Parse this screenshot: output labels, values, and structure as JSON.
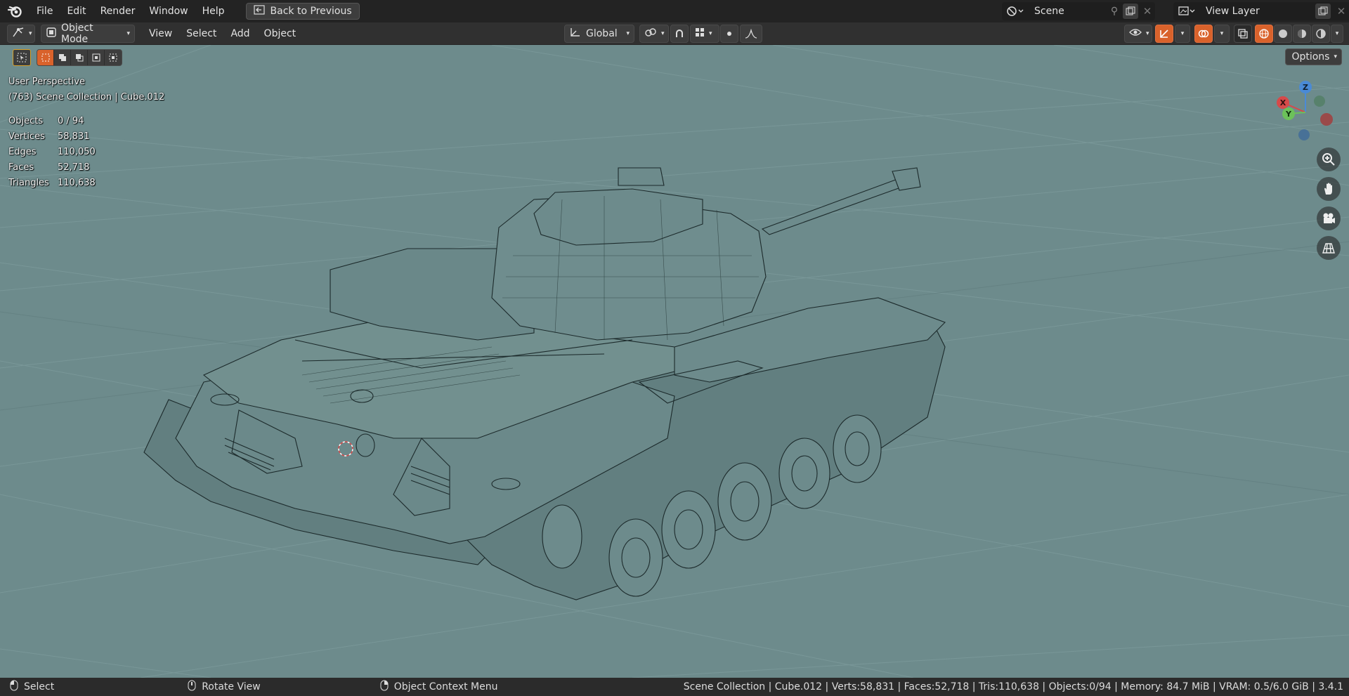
{
  "topbar": {
    "menus": [
      "File",
      "Edit",
      "Render",
      "Window",
      "Help"
    ],
    "back_label": "Back to Previous",
    "scene_name": "Scene",
    "view_layer": "View Layer"
  },
  "header": {
    "mode": "Object Mode",
    "menus": [
      "View",
      "Select",
      "Add",
      "Object"
    ],
    "orientation": "Global",
    "options_label": "Options"
  },
  "overlay": {
    "perspective": "User Perspective",
    "collection": "(763) Scene Collection | Cube.012",
    "stats": [
      {
        "label": "Objects",
        "value": "0 / 94"
      },
      {
        "label": "Vertices",
        "value": "58,831"
      },
      {
        "label": "Edges",
        "value": "110,050"
      },
      {
        "label": "Faces",
        "value": "52,718"
      },
      {
        "label": "Triangles",
        "value": "110,638"
      }
    ]
  },
  "gizmo": {
    "x": "X",
    "y": "Y",
    "z": "Z"
  },
  "statusbar": {
    "select": "Select",
    "rotate": "Rotate View",
    "context": "Object Context Menu",
    "info": "Scene Collection | Cube.012 | Verts:58,831 | Faces:52,718 | Tris:110,638 | Objects:0/94 | Memory: 84.7 MiB | VRAM: 0.5/6.0 GiB | 3.4.1"
  },
  "icons": [
    "blender-logo-icon",
    "back-icon",
    "scene-icon",
    "pin-icon",
    "copy-icon",
    "close-icon",
    "view-layer-icon",
    "editor-type-icon",
    "object-mode-icon",
    "orientation-icon",
    "snap-icon",
    "proportional-icon",
    "visibility-icon",
    "gizmo-icon",
    "overlay-icon",
    "xray-icon",
    "wireframe-shading-icon",
    "solid-shading-icon",
    "material-shading-icon",
    "rendered-shading-icon",
    "zoom-icon",
    "hand-icon",
    "camera-icon",
    "grid-view-icon",
    "mouse-left-icon",
    "mouse-middle-icon",
    "mouse-right-icon"
  ],
  "colors": {
    "viewport_bg": "#6d8b8c",
    "accent": "#d9622b",
    "x_axis": "#d64a4a",
    "y_axis": "#6cc15a",
    "z_axis": "#4a8ad6"
  }
}
